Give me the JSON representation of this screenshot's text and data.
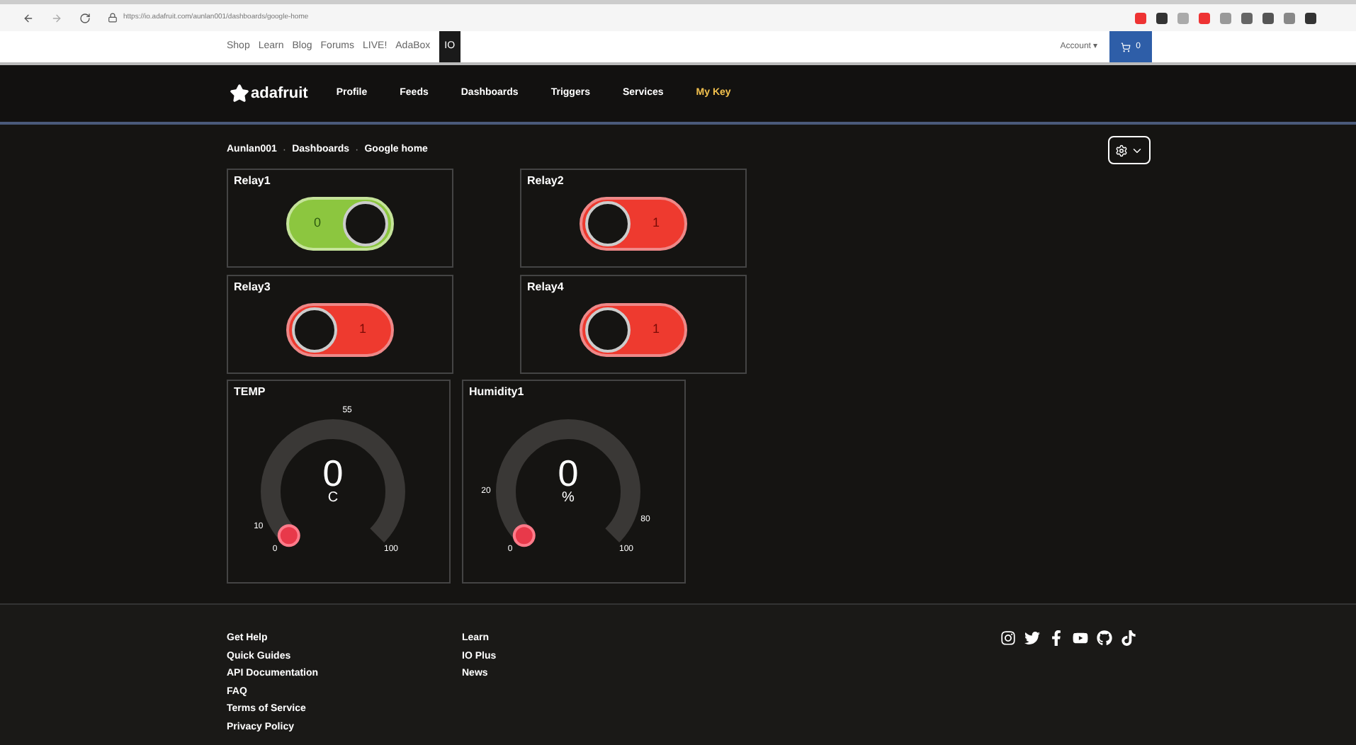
{
  "browser": {
    "url": "https://io.adafruit.com/aunlan001/dashboards/google-home"
  },
  "top_nav": {
    "links": [
      {
        "label": "Shop",
        "selected": false
      },
      {
        "label": "Learn",
        "selected": false
      },
      {
        "label": "Blog",
        "selected": false
      },
      {
        "label": "Forums",
        "selected": false
      },
      {
        "label": "LIVE!",
        "selected": false
      },
      {
        "label": "AdaBox",
        "selected": false
      },
      {
        "label": "IO",
        "selected": true
      }
    ],
    "account": "Account ▾",
    "cart": "0"
  },
  "main_nav": {
    "logo": "adafruit",
    "links": [
      {
        "label": "Profile",
        "highlight": false
      },
      {
        "label": "Feeds",
        "highlight": false
      },
      {
        "label": "Dashboards",
        "highlight": false
      },
      {
        "label": "Triggers",
        "highlight": false
      },
      {
        "label": "Services",
        "highlight": false
      },
      {
        "label": "My Key",
        "highlight": true
      }
    ]
  },
  "breadcrumb": {
    "items": [
      "Aunlan001",
      "Dashboards",
      "Google home"
    ],
    "separator": "·"
  },
  "toggles": [
    {
      "title": "Relay1",
      "on": true,
      "label": "0"
    },
    {
      "title": "Relay2",
      "on": false,
      "label": "1"
    },
    {
      "title": "Relay3",
      "on": false,
      "label": "1"
    },
    {
      "title": "Relay4",
      "on": false,
      "label": "1"
    }
  ],
  "gauges": [
    {
      "title": "TEMP",
      "value": "0",
      "unit": "C",
      "ticks": [
        "0",
        "10",
        "55",
        "100"
      ]
    },
    {
      "title": "Humidity1",
      "value": "0",
      "unit": "%",
      "ticks": [
        "0",
        "20",
        "80",
        "100"
      ]
    }
  ],
  "footer": {
    "column_1": [
      "Get Help",
      "Quick Guides",
      "API Documentation",
      "FAQ",
      "Terms of Service",
      "Privacy Policy"
    ],
    "column_2": [
      "Learn",
      "IO Plus",
      "News"
    ]
  }
}
